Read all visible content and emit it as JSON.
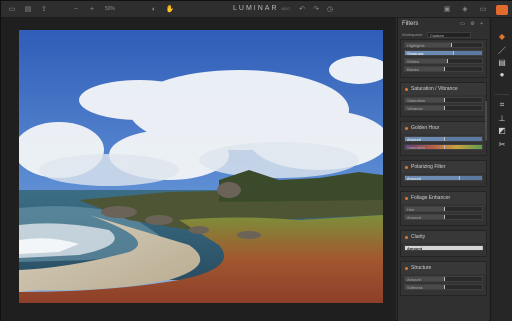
{
  "app": {
    "logo": "LUMINAR",
    "logo_sub": "NEO"
  },
  "toolbar": {
    "zoom": "50%"
  },
  "panel": {
    "title": "Filters",
    "workspace_label": "Workspace:",
    "workspace_value": "Custom"
  },
  "filters": [
    {
      "name": "",
      "sliders": [
        {
          "label": "Highlights",
          "value": "",
          "level": 0.6
        },
        {
          "label": "Shadows",
          "value": "",
          "level": 0.62,
          "selected": true
        },
        {
          "label": "Whites",
          "value": "",
          "level": 0.55
        },
        {
          "label": "Blacks",
          "value": "",
          "level": 0.5
        }
      ]
    },
    {
      "name": "Saturation / Vibrance",
      "sliders": [
        {
          "label": "Saturation",
          "value": "",
          "level": 0.5
        },
        {
          "label": "Vibrance",
          "value": "",
          "level": 0.5
        }
      ]
    },
    {
      "name": "Golden Hour",
      "sliders": [
        {
          "label": "Amount",
          "value": "",
          "level": 0.5,
          "selected": true
        },
        {
          "label": "Saturation",
          "value": "",
          "level": 0.5,
          "gradient": true
        }
      ]
    },
    {
      "name": "Polarizing Filter",
      "sliders": [
        {
          "label": "Amount",
          "value": "",
          "level": 0.7,
          "selected": true
        }
      ]
    },
    {
      "name": "Foliage Enhancer",
      "sliders": [
        {
          "label": "Hue",
          "value": "",
          "level": 0.5
        },
        {
          "label": "Amount",
          "value": "",
          "level": 0.5
        }
      ]
    },
    {
      "name": "Clarity",
      "sliders": [
        {
          "label": "Amount",
          "value": "",
          "level": 1.0,
          "amount": true
        }
      ]
    },
    {
      "name": "Structure",
      "sliders": [
        {
          "label": "Amount",
          "value": "",
          "level": 0.5
        },
        {
          "label": "Softness",
          "value": "",
          "level": 0.5
        }
      ]
    }
  ],
  "colors": {
    "accent": "#e0752f",
    "selected": "#5a7aa0"
  }
}
